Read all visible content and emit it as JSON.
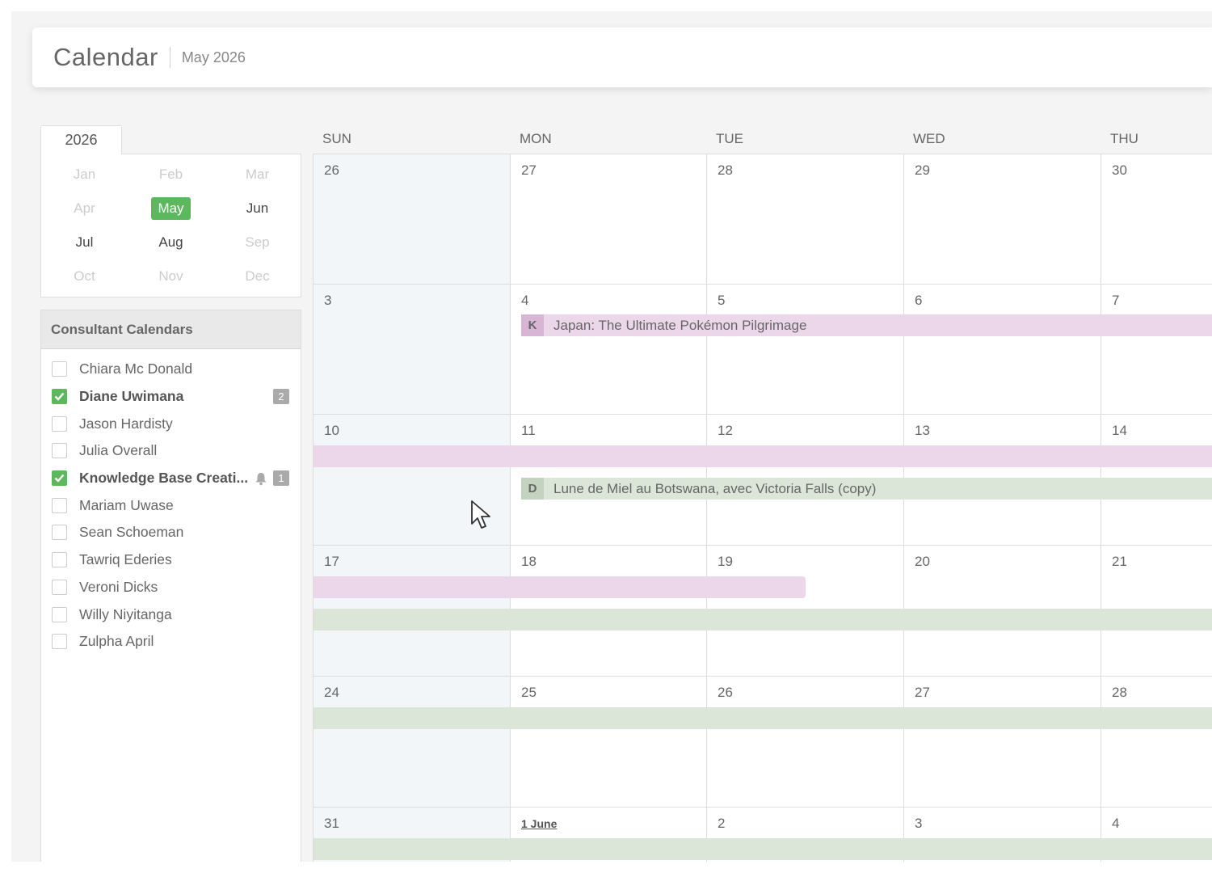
{
  "header": {
    "title": "Calendar",
    "subtitle": "May 2026"
  },
  "year_picker": {
    "year": "2026",
    "months": [
      {
        "label": "Jan",
        "state": "disabled"
      },
      {
        "label": "Feb",
        "state": "disabled"
      },
      {
        "label": "Mar",
        "state": "disabled"
      },
      {
        "label": "Apr",
        "state": "disabled"
      },
      {
        "label": "May",
        "state": "selected"
      },
      {
        "label": "Jun",
        "state": "enabled"
      },
      {
        "label": "Jul",
        "state": "enabled"
      },
      {
        "label": "Aug",
        "state": "enabled"
      },
      {
        "label": "Sep",
        "state": "disabled"
      },
      {
        "label": "Oct",
        "state": "disabled"
      },
      {
        "label": "Nov",
        "state": "disabled"
      },
      {
        "label": "Dec",
        "state": "disabled"
      }
    ]
  },
  "consultants": {
    "title": "Consultant Calendars",
    "items": [
      {
        "name": "Chiara Mc Donald",
        "checked": false,
        "badge": "",
        "bell": false
      },
      {
        "name": "Diane Uwimana",
        "checked": true,
        "badge": "2",
        "bell": false
      },
      {
        "name": "Jason Hardisty",
        "checked": false,
        "badge": "",
        "bell": false
      },
      {
        "name": "Julia Overall",
        "checked": false,
        "badge": "",
        "bell": false
      },
      {
        "name": "Knowledge Base Creati...",
        "checked": true,
        "badge": "1",
        "bell": true
      },
      {
        "name": "Mariam Uwase",
        "checked": false,
        "badge": "",
        "bell": false
      },
      {
        "name": "Sean Schoeman",
        "checked": false,
        "badge": "",
        "bell": false
      },
      {
        "name": "Tawriq Ederies",
        "checked": false,
        "badge": "",
        "bell": false
      },
      {
        "name": "Veroni Dicks",
        "checked": false,
        "badge": "",
        "bell": false
      },
      {
        "name": "Willy Niyitanga",
        "checked": false,
        "badge": "",
        "bell": false
      },
      {
        "name": "Zulpha April",
        "checked": false,
        "badge": "",
        "bell": false
      }
    ]
  },
  "calendar": {
    "days_of_week": [
      "SUN",
      "MON",
      "TUE",
      "WED",
      "THU"
    ],
    "weeks": [
      [
        "26",
        "27",
        "28",
        "29",
        "30"
      ],
      [
        "3",
        "4",
        "5",
        "6",
        "7"
      ],
      [
        "10",
        "11",
        "12",
        "13",
        "14"
      ],
      [
        "17",
        "18",
        "19",
        "20",
        "21"
      ],
      [
        "24",
        "25",
        "26",
        "27",
        "28"
      ],
      [
        "31",
        "1 June",
        "2",
        "3",
        "4"
      ]
    ],
    "events": [
      {
        "letter": "K",
        "title": "Japan: The Ultimate Pokémon Pilgrimage",
        "color": "pink"
      },
      {
        "letter": "D",
        "title": "Lune de Miel au Botswana, avec Victoria Falls (copy)",
        "color": "green"
      }
    ]
  },
  "colors": {
    "accent_green": "#5cb85c",
    "event_pink": "#ecd6ea",
    "event_green": "#dbe6d8"
  }
}
